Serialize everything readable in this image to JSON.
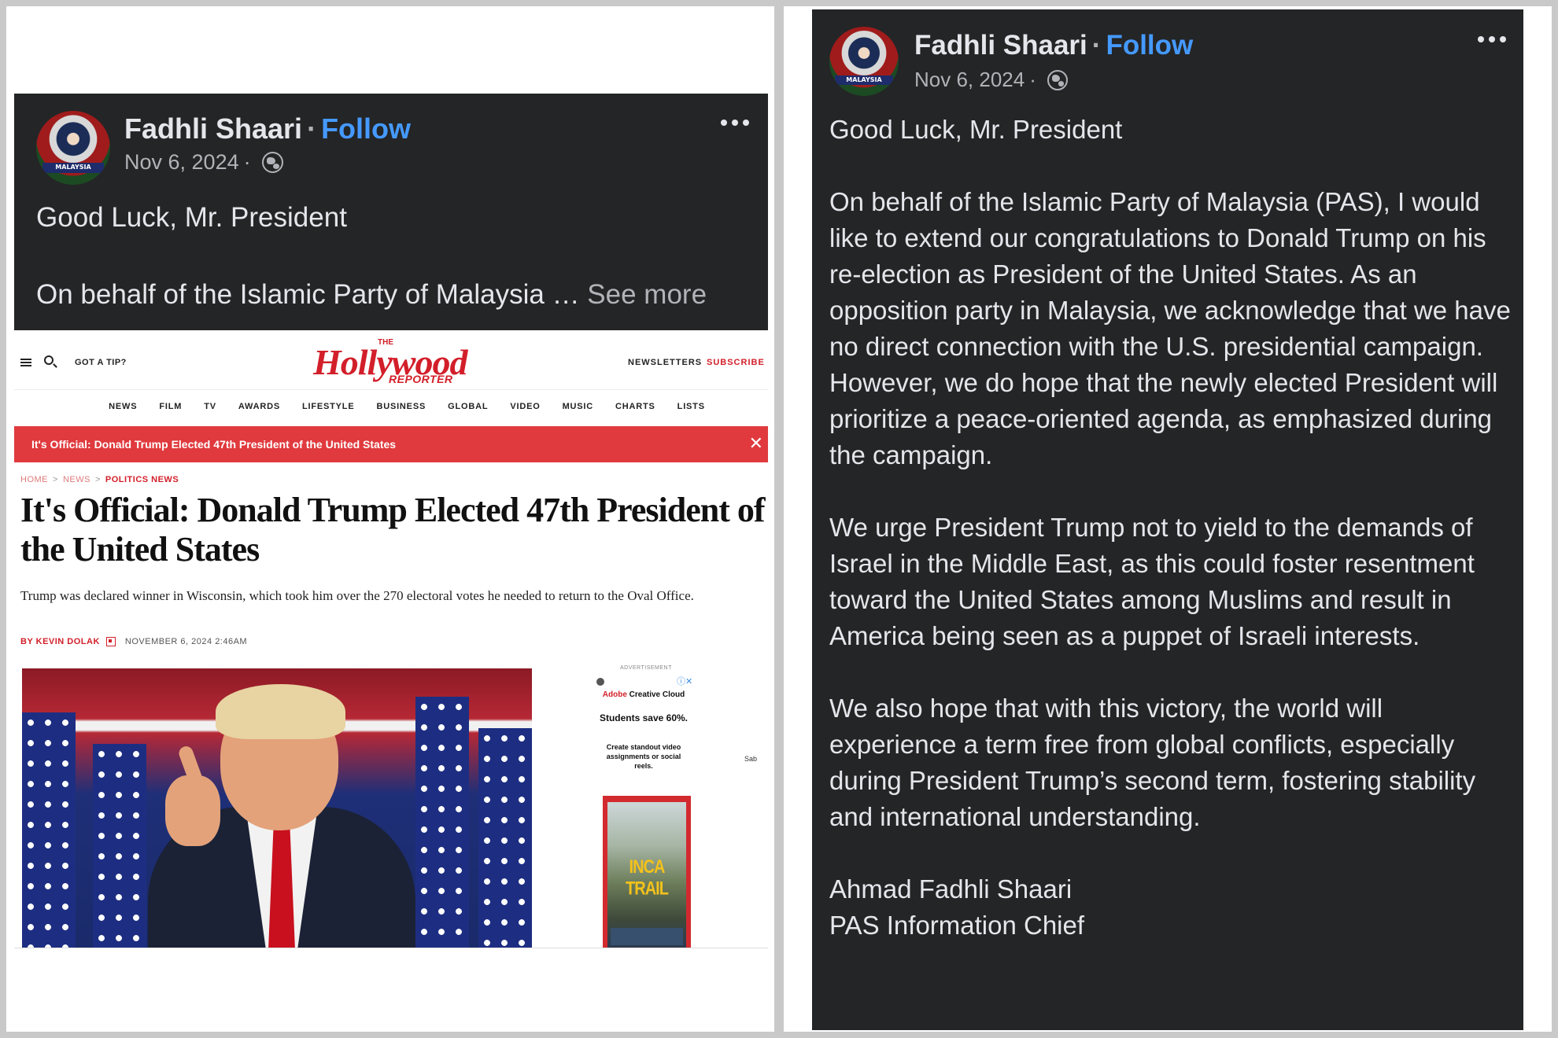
{
  "left_post": {
    "author": "Fadhli Shaari",
    "separator": "·",
    "follow_label": "Follow",
    "date": "Nov 6, 2024",
    "meta_separator": "·",
    "title": "Good Luck, Mr. President",
    "excerpt": "On behalf of the Islamic Party of Malaysia … ",
    "see_more_label": "See more",
    "avatar_text": "MALAYSIA"
  },
  "article": {
    "got_a_tip": "GOT A TIP?",
    "logo_the": "THE",
    "logo_main": "Hollywood",
    "logo_sub": "REPORTER",
    "newsletters": "NEWSLETTERS",
    "subscribe": "SUBSCRIBE",
    "nav": [
      "NEWS",
      "FILM",
      "TV",
      "AWARDS",
      "LIFESTYLE",
      "BUSINESS",
      "GLOBAL",
      "VIDEO",
      "MUSIC",
      "CHARTS",
      "LISTS"
    ],
    "alert": "It's Official: Donald Trump Elected 47th President of the United States",
    "close_glyph": "✕",
    "breadcrumb": [
      "HOME",
      "NEWS",
      "POLITICS NEWS"
    ],
    "breadcrumb_sep": ">",
    "headline": "It's Official: Donald Trump Elected 47th President of the United States",
    "dek": "Trump was declared winner in Wisconsin, which took him over the 270 electoral votes he needed to return to the Oval Office.",
    "author": "BY KEVIN DOLAK",
    "date": "NOVEMBER 6, 2024 2:46AM",
    "ad": {
      "label": "ADVERTISEMENT",
      "close": "ⓘ✕",
      "brand_adobe": "Adobe",
      "brand_rest": " Creative Cloud",
      "headline": "Students save 60%.",
      "sub": "Create standout video assignments or social reels.",
      "side_text": "Sab",
      "image_text": "INCA TRAIL"
    }
  },
  "right_post": {
    "author": "Fadhli Shaari",
    "separator": "·",
    "follow_label": "Follow",
    "date": "Nov 6, 2024",
    "meta_separator": "·",
    "avatar_text": "MALAYSIA",
    "title": "Good Luck, Mr. President",
    "paragraphs": [
      "On behalf of the Islamic Party of Malaysia (PAS), I would like to extend our congratulations to Donald Trump on his re-election as President of the United States. As an opposition party in Malaysia, we acknowledge that we have no direct connection with the U.S. presidential campaign. However, we do hope that the newly elected President will prioritize a peace-oriented agenda, as emphasized during the campaign.",
      "We urge President Trump not to yield to the demands of Israel in the Middle East, as this could foster resentment toward the United States among Muslims and result in America being seen as a puppet of Israeli interests.",
      "We also hope that with this victory, the world will experience a term free from global conflicts, especially during President Trump’s second term, fostering stability and international understanding."
    ],
    "signature_name": "Ahmad Fadhli Shaari",
    "signature_title": "PAS Information Chief"
  }
}
